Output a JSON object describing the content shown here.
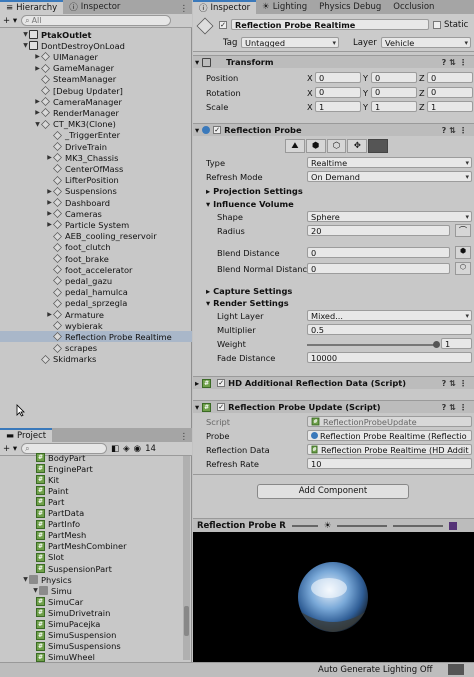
{
  "hierarchy": {
    "tab_label": "Hierarchy",
    "add_label": "+ ▾",
    "search_placeholder": "All",
    "rows": [
      {
        "label": "PtakOutlet",
        "depth": 0,
        "bold": true,
        "expanded": true,
        "icon": "unity-scene-icon"
      },
      {
        "label": "DontDestroyOnLoad",
        "depth": 0,
        "bold": false,
        "expanded": true,
        "icon": "unity-scene-icon"
      },
      {
        "label": "UIManager",
        "depth": 1,
        "expanded": false,
        "icon": "gameobject-icon"
      },
      {
        "label": "GameManager",
        "depth": 1,
        "expanded": false,
        "icon": "gameobject-icon"
      },
      {
        "label": "SteamManager",
        "depth": 1,
        "expanded": null,
        "icon": "gameobject-icon"
      },
      {
        "label": "[Debug Updater]",
        "depth": 1,
        "expanded": null,
        "icon": "gameobject-icon"
      },
      {
        "label": "CameraManager",
        "depth": 1,
        "expanded": false,
        "icon": "gameobject-icon"
      },
      {
        "label": "RenderManager",
        "depth": 1,
        "expanded": false,
        "icon": "gameobject-icon"
      },
      {
        "label": "CT_MK3(Clone)",
        "depth": 1,
        "expanded": true,
        "icon": "gameobject-icon"
      },
      {
        "label": "_TriggerEnter",
        "depth": 2,
        "expanded": null,
        "icon": "gameobject-icon"
      },
      {
        "label": "DriveTrain",
        "depth": 2,
        "expanded": null,
        "icon": "gameobject-icon"
      },
      {
        "label": "MK3_Chassis",
        "depth": 2,
        "expanded": false,
        "icon": "gameobject-icon"
      },
      {
        "label": "CenterOfMass",
        "depth": 2,
        "expanded": null,
        "icon": "gameobject-icon"
      },
      {
        "label": "LifterPosition",
        "depth": 2,
        "expanded": null,
        "icon": "gameobject-icon"
      },
      {
        "label": "Suspensions",
        "depth": 2,
        "expanded": false,
        "icon": "gameobject-icon"
      },
      {
        "label": "Dashboard",
        "depth": 2,
        "expanded": false,
        "icon": "gameobject-icon"
      },
      {
        "label": "Cameras",
        "depth": 2,
        "expanded": false,
        "icon": "gameobject-icon"
      },
      {
        "label": "Particle System",
        "depth": 2,
        "expanded": false,
        "icon": "gameobject-icon"
      },
      {
        "label": "AEB_cooling_reservoir",
        "depth": 2,
        "expanded": null,
        "icon": "gameobject-icon"
      },
      {
        "label": "foot_clutch",
        "depth": 2,
        "expanded": null,
        "icon": "gameobject-icon"
      },
      {
        "label": "foot_brake",
        "depth": 2,
        "expanded": null,
        "icon": "gameobject-icon"
      },
      {
        "label": "foot_accelerator",
        "depth": 2,
        "expanded": null,
        "icon": "gameobject-icon"
      },
      {
        "label": "pedal_gazu",
        "depth": 2,
        "expanded": null,
        "icon": "gameobject-icon"
      },
      {
        "label": "pedal_hamulca",
        "depth": 2,
        "expanded": null,
        "icon": "gameobject-icon"
      },
      {
        "label": "pedal_sprzegla",
        "depth": 2,
        "expanded": null,
        "icon": "gameobject-icon"
      },
      {
        "label": "Armature",
        "depth": 2,
        "expanded": false,
        "icon": "gameobject-icon"
      },
      {
        "label": "wybierak",
        "depth": 2,
        "expanded": null,
        "icon": "gameobject-icon"
      },
      {
        "label": "Reflection Probe Realtime",
        "depth": 2,
        "expanded": null,
        "icon": "gameobject-icon",
        "selected": true
      },
      {
        "label": "scrapes",
        "depth": 2,
        "expanded": null,
        "icon": "gameobject-icon"
      },
      {
        "label": "Skidmarks",
        "depth": 1,
        "expanded": null,
        "icon": "gameobject-icon"
      }
    ]
  },
  "project": {
    "tab_label": "Project",
    "add_label": "+ ▾",
    "count_label": "14",
    "rows": [
      {
        "label": "BodyPart",
        "type": "script",
        "depth": 3
      },
      {
        "label": "EnginePart",
        "type": "script",
        "depth": 3
      },
      {
        "label": "Kit",
        "type": "script",
        "depth": 3
      },
      {
        "label": "Paint",
        "type": "script",
        "depth": 3
      },
      {
        "label": "Part",
        "type": "script",
        "depth": 3
      },
      {
        "label": "PartData",
        "type": "script",
        "depth": 3
      },
      {
        "label": "PartInfo",
        "type": "script",
        "depth": 3
      },
      {
        "label": "PartMesh",
        "type": "script",
        "depth": 3
      },
      {
        "label": "PartMeshCombiner",
        "type": "script",
        "depth": 3
      },
      {
        "label": "Slot",
        "type": "script",
        "depth": 3
      },
      {
        "label": "SuspensionPart",
        "type": "script",
        "depth": 3
      },
      {
        "label": "Physics",
        "type": "folder",
        "depth": 1,
        "expanded": true
      },
      {
        "label": "Simu",
        "type": "folder",
        "depth": 2,
        "expanded": true
      },
      {
        "label": "SimuCar",
        "type": "script",
        "depth": 3
      },
      {
        "label": "SimuDrivetrain",
        "type": "script",
        "depth": 3
      },
      {
        "label": "SimuPacejka",
        "type": "script",
        "depth": 3
      },
      {
        "label": "SimuSuspension",
        "type": "script",
        "depth": 3
      },
      {
        "label": "SimuSuspensions",
        "type": "script",
        "depth": 3
      },
      {
        "label": "SimuWheel",
        "type": "script",
        "depth": 3
      }
    ]
  },
  "inspector": {
    "tabs": [
      "Inspector",
      "Lighting",
      "Physics Debug",
      "Occlusion"
    ],
    "object_name": "Reflection Probe Realtime",
    "static_label": "Static",
    "tag_label": "Tag",
    "tag_value": "Untagged",
    "layer_label": "Layer",
    "layer_value": "Vehicle",
    "transform": {
      "title": "Transform",
      "rows": [
        {
          "label": "Position",
          "x": "0",
          "y": "0",
          "z": "0"
        },
        {
          "label": "Rotation",
          "x": "0",
          "y": "0",
          "z": "0"
        },
        {
          "label": "Scale",
          "x": "1",
          "y": "1",
          "z": "1"
        }
      ]
    },
    "reflection_probe": {
      "title": "Reflection Probe",
      "type_label": "Type",
      "type_value": "Realtime",
      "refresh_label": "Refresh Mode",
      "refresh_value": "On Demand",
      "projection_label": "Projection Settings",
      "influence_label": "Influence Volume",
      "shape_label": "Shape",
      "shape_value": "Sphere",
      "radius_label": "Radius",
      "radius_value": "20",
      "blend_label": "Blend Distance",
      "blend_value": "0",
      "blend_normal_label": "Blend Normal Distance",
      "blend_normal_value": "0",
      "capture_label": "Capture Settings",
      "render_label": "Render Settings",
      "light_layer_label": "Light Layer",
      "light_layer_value": "Mixed...",
      "multiplier_label": "Multiplier",
      "multiplier_value": "0.5",
      "weight_label": "Weight",
      "weight_value": "1",
      "weight_fraction": 1.0,
      "fade_label": "Fade Distance",
      "fade_value": "10000"
    },
    "hd_additional": {
      "title": "HD Additional Reflection Data (Script)"
    },
    "probe_update": {
      "title": "Reflection Probe Update (Script)",
      "script_label": "Script",
      "script_value": "ReflectionProbeUpdate",
      "probe_label": "Probe",
      "probe_value": "Reflection Probe Realtime (Reflectio",
      "data_label": "Reflection Data",
      "data_value": "Reflection Probe Realtime (HD Addit",
      "rate_label": "Refresh Rate",
      "rate_value": "10"
    },
    "add_component_label": "Add Component",
    "preview_title": "Reflection Probe R"
  },
  "status_bar": {
    "text": "Auto Generate Lighting Off"
  },
  "colors": {
    "selection": "#a9b7c9",
    "accent": "#3a79bb",
    "script_icon": "#6fa04a"
  }
}
